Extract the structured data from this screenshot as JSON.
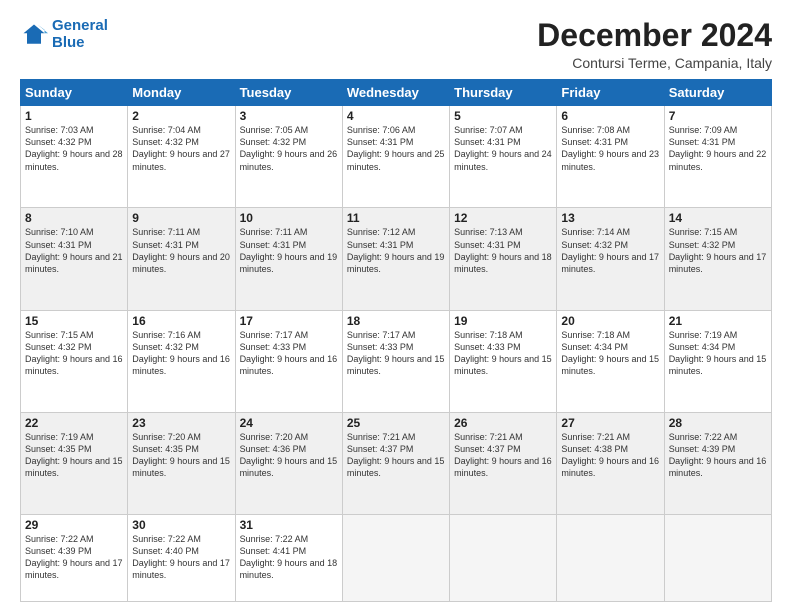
{
  "header": {
    "logo_line1": "General",
    "logo_line2": "Blue",
    "month": "December 2024",
    "location": "Contursi Terme, Campania, Italy"
  },
  "weekdays": [
    "Sunday",
    "Monday",
    "Tuesday",
    "Wednesday",
    "Thursday",
    "Friday",
    "Saturday"
  ],
  "weeks": [
    [
      {
        "day": "1",
        "sunrise": "Sunrise: 7:03 AM",
        "sunset": "Sunset: 4:32 PM",
        "daylight": "Daylight: 9 hours and 28 minutes."
      },
      {
        "day": "2",
        "sunrise": "Sunrise: 7:04 AM",
        "sunset": "Sunset: 4:32 PM",
        "daylight": "Daylight: 9 hours and 27 minutes."
      },
      {
        "day": "3",
        "sunrise": "Sunrise: 7:05 AM",
        "sunset": "Sunset: 4:32 PM",
        "daylight": "Daylight: 9 hours and 26 minutes."
      },
      {
        "day": "4",
        "sunrise": "Sunrise: 7:06 AM",
        "sunset": "Sunset: 4:31 PM",
        "daylight": "Daylight: 9 hours and 25 minutes."
      },
      {
        "day": "5",
        "sunrise": "Sunrise: 7:07 AM",
        "sunset": "Sunset: 4:31 PM",
        "daylight": "Daylight: 9 hours and 24 minutes."
      },
      {
        "day": "6",
        "sunrise": "Sunrise: 7:08 AM",
        "sunset": "Sunset: 4:31 PM",
        "daylight": "Daylight: 9 hours and 23 minutes."
      },
      {
        "day": "7",
        "sunrise": "Sunrise: 7:09 AM",
        "sunset": "Sunset: 4:31 PM",
        "daylight": "Daylight: 9 hours and 22 minutes."
      }
    ],
    [
      {
        "day": "8",
        "sunrise": "Sunrise: 7:10 AM",
        "sunset": "Sunset: 4:31 PM",
        "daylight": "Daylight: 9 hours and 21 minutes."
      },
      {
        "day": "9",
        "sunrise": "Sunrise: 7:11 AM",
        "sunset": "Sunset: 4:31 PM",
        "daylight": "Daylight: 9 hours and 20 minutes."
      },
      {
        "day": "10",
        "sunrise": "Sunrise: 7:11 AM",
        "sunset": "Sunset: 4:31 PM",
        "daylight": "Daylight: 9 hours and 19 minutes."
      },
      {
        "day": "11",
        "sunrise": "Sunrise: 7:12 AM",
        "sunset": "Sunset: 4:31 PM",
        "daylight": "Daylight: 9 hours and 19 minutes."
      },
      {
        "day": "12",
        "sunrise": "Sunrise: 7:13 AM",
        "sunset": "Sunset: 4:31 PM",
        "daylight": "Daylight: 9 hours and 18 minutes."
      },
      {
        "day": "13",
        "sunrise": "Sunrise: 7:14 AM",
        "sunset": "Sunset: 4:32 PM",
        "daylight": "Daylight: 9 hours and 17 minutes."
      },
      {
        "day": "14",
        "sunrise": "Sunrise: 7:15 AM",
        "sunset": "Sunset: 4:32 PM",
        "daylight": "Daylight: 9 hours and 17 minutes."
      }
    ],
    [
      {
        "day": "15",
        "sunrise": "Sunrise: 7:15 AM",
        "sunset": "Sunset: 4:32 PM",
        "daylight": "Daylight: 9 hours and 16 minutes."
      },
      {
        "day": "16",
        "sunrise": "Sunrise: 7:16 AM",
        "sunset": "Sunset: 4:32 PM",
        "daylight": "Daylight: 9 hours and 16 minutes."
      },
      {
        "day": "17",
        "sunrise": "Sunrise: 7:17 AM",
        "sunset": "Sunset: 4:33 PM",
        "daylight": "Daylight: 9 hours and 16 minutes."
      },
      {
        "day": "18",
        "sunrise": "Sunrise: 7:17 AM",
        "sunset": "Sunset: 4:33 PM",
        "daylight": "Daylight: 9 hours and 15 minutes."
      },
      {
        "day": "19",
        "sunrise": "Sunrise: 7:18 AM",
        "sunset": "Sunset: 4:33 PM",
        "daylight": "Daylight: 9 hours and 15 minutes."
      },
      {
        "day": "20",
        "sunrise": "Sunrise: 7:18 AM",
        "sunset": "Sunset: 4:34 PM",
        "daylight": "Daylight: 9 hours and 15 minutes."
      },
      {
        "day": "21",
        "sunrise": "Sunrise: 7:19 AM",
        "sunset": "Sunset: 4:34 PM",
        "daylight": "Daylight: 9 hours and 15 minutes."
      }
    ],
    [
      {
        "day": "22",
        "sunrise": "Sunrise: 7:19 AM",
        "sunset": "Sunset: 4:35 PM",
        "daylight": "Daylight: 9 hours and 15 minutes."
      },
      {
        "day": "23",
        "sunrise": "Sunrise: 7:20 AM",
        "sunset": "Sunset: 4:35 PM",
        "daylight": "Daylight: 9 hours and 15 minutes."
      },
      {
        "day": "24",
        "sunrise": "Sunrise: 7:20 AM",
        "sunset": "Sunset: 4:36 PM",
        "daylight": "Daylight: 9 hours and 15 minutes."
      },
      {
        "day": "25",
        "sunrise": "Sunrise: 7:21 AM",
        "sunset": "Sunset: 4:37 PM",
        "daylight": "Daylight: 9 hours and 15 minutes."
      },
      {
        "day": "26",
        "sunrise": "Sunrise: 7:21 AM",
        "sunset": "Sunset: 4:37 PM",
        "daylight": "Daylight: 9 hours and 16 minutes."
      },
      {
        "day": "27",
        "sunrise": "Sunrise: 7:21 AM",
        "sunset": "Sunset: 4:38 PM",
        "daylight": "Daylight: 9 hours and 16 minutes."
      },
      {
        "day": "28",
        "sunrise": "Sunrise: 7:22 AM",
        "sunset": "Sunset: 4:39 PM",
        "daylight": "Daylight: 9 hours and 16 minutes."
      }
    ],
    [
      {
        "day": "29",
        "sunrise": "Sunrise: 7:22 AM",
        "sunset": "Sunset: 4:39 PM",
        "daylight": "Daylight: 9 hours and 17 minutes."
      },
      {
        "day": "30",
        "sunrise": "Sunrise: 7:22 AM",
        "sunset": "Sunset: 4:40 PM",
        "daylight": "Daylight: 9 hours and 17 minutes."
      },
      {
        "day": "31",
        "sunrise": "Sunrise: 7:22 AM",
        "sunset": "Sunset: 4:41 PM",
        "daylight": "Daylight: 9 hours and 18 minutes."
      },
      null,
      null,
      null,
      null
    ]
  ]
}
